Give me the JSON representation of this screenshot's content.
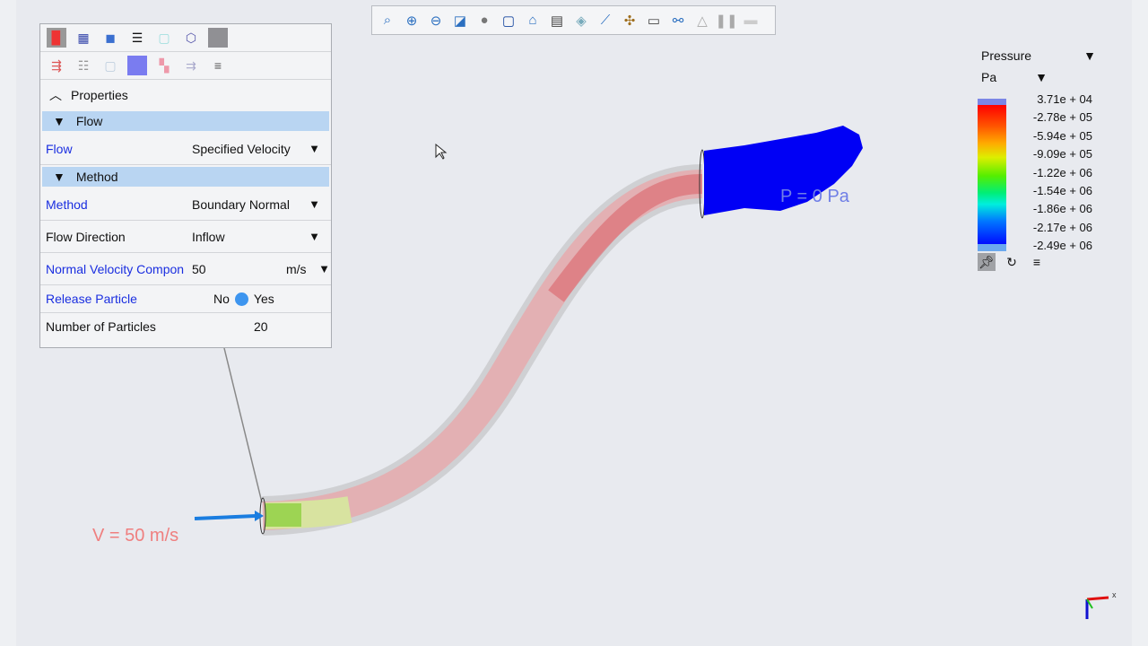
{
  "toolbar": {
    "icons": [
      "zoom-fit-icon",
      "zoom-in-icon",
      "zoom-out-icon",
      "zoom-box-icon",
      "shading-icon",
      "box-view-icon",
      "home-view-icon",
      "screenshot-icon",
      "transparency-icon",
      "section-icon",
      "axes-icon",
      "display-icon",
      "graph-icon",
      "triangle-icon",
      "pause-icon",
      "record-icon"
    ]
  },
  "panel": {
    "properties_label": "Properties",
    "sections": {
      "flow": "Flow",
      "method": "Method"
    },
    "rows": {
      "flow": {
        "label": "Flow",
        "value": "Specified Velocity"
      },
      "method": {
        "label": "Method",
        "value": "Boundary Normal"
      },
      "flow_direction": {
        "label": "Flow Direction",
        "value": "Inflow"
      },
      "normal_velocity": {
        "label": "Normal Velocity Compon",
        "value": "50",
        "unit": "m/s"
      },
      "release_particle": {
        "label": "Release Particle",
        "no": "No",
        "yes": "Yes"
      },
      "num_particles": {
        "label": "Number of Particles",
        "value": "20"
      }
    }
  },
  "legend": {
    "quantity": "Pressure",
    "unit": "Pa",
    "ticks": [
      "3.71e + 04",
      "-2.78e + 05",
      "-5.94e + 05",
      "-9.09e + 05",
      "-1.22e + 06",
      "-1.54e + 06",
      "-1.86e + 06",
      "-2.17e + 06",
      "-2.49e + 06"
    ]
  },
  "annotations": {
    "velocity": "V = 50 m/s",
    "pressure": "P = 0 Pa"
  },
  "axes": {
    "x": "x"
  }
}
